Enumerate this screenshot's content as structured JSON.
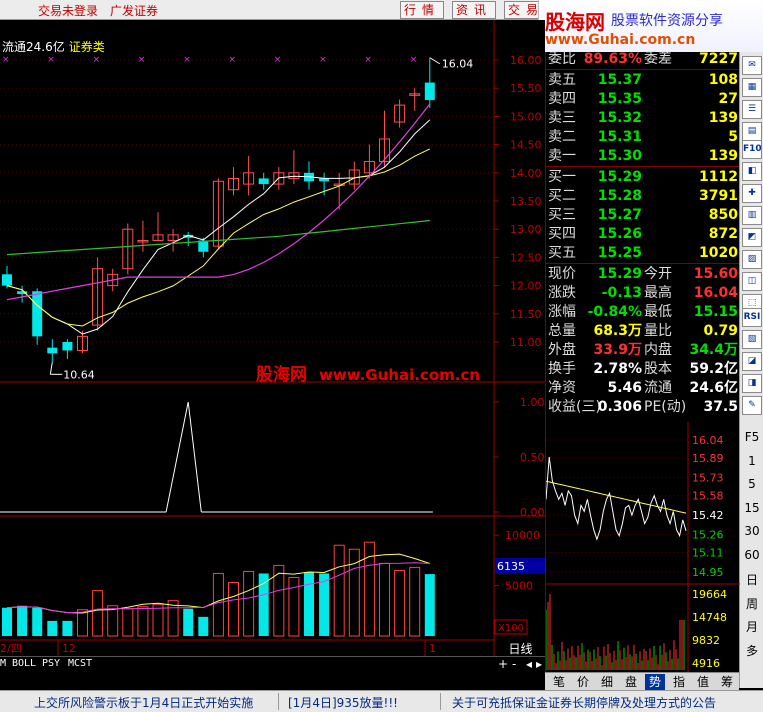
{
  "topbar": {
    "links": [
      "交易未登录",
      "广发证券"
    ],
    "buttons": [
      "行情",
      "资讯",
      "交易"
    ]
  },
  "brand": {
    "logo": "股海网",
    "slogan": "股票软件资源分享",
    "url": "www.Guhai.com.cn"
  },
  "chart_header": {
    "float_label": "流通24.6亿",
    "sector": "证券类"
  },
  "price_axis": [
    "16.00",
    "15.50",
    "15.00",
    "14.50",
    "14.00",
    "13.50",
    "13.00",
    "12.50",
    "12.00",
    "11.50",
    "11.00"
  ],
  "indicator_axis": [
    "1.00",
    "0.50",
    "0.00"
  ],
  "volume_axis": [
    "10000",
    "5000"
  ],
  "volume_marker": "6135",
  "volume_unit": "X100",
  "annotations": {
    "high": "16.04",
    "low": "10.64"
  },
  "watermark": {
    "text": "股海网",
    "url": "www.Guhai.com.cn"
  },
  "quote": {
    "top_row": {
      "label": "委比",
      "value": "89.63%",
      "label2": "委差",
      "value2": "7227"
    },
    "asks": [
      {
        "label": "卖五",
        "price": "15.37",
        "vol": "108"
      },
      {
        "label": "卖四",
        "price": "15.35",
        "vol": "27"
      },
      {
        "label": "卖三",
        "price": "15.32",
        "vol": "139"
      },
      {
        "label": "卖二",
        "price": "15.31",
        "vol": "5"
      },
      {
        "label": "卖一",
        "price": "15.30",
        "vol": "139"
      }
    ],
    "bids": [
      {
        "label": "买一",
        "price": "15.29",
        "vol": "1112"
      },
      {
        "label": "买二",
        "price": "15.28",
        "vol": "3791"
      },
      {
        "label": "买三",
        "price": "15.27",
        "vol": "850"
      },
      {
        "label": "买四",
        "price": "15.26",
        "vol": "872"
      },
      {
        "label": "买五",
        "price": "15.25",
        "vol": "1020"
      }
    ],
    "stats": [
      {
        "l1": "现价",
        "v1": "15.29",
        "l2": "今开",
        "v2": "15.60"
      },
      {
        "l1": "涨跌",
        "v1": "-0.13",
        "l2": "最高",
        "v2": "16.04"
      },
      {
        "l1": "涨幅",
        "v1": "-0.84%",
        "l2": "最低",
        "v2": "15.15"
      },
      {
        "l1": "总量",
        "v1": "68.3万",
        "l2": "量比",
        "v2": "0.79"
      },
      {
        "l1": "外盘",
        "v1": "33.9万",
        "l2": "内盘",
        "v2": "34.4万"
      },
      {
        "l1": "换手",
        "v1": "2.78%",
        "l2": "股本",
        "v2": "59.2亿"
      },
      {
        "l1": "净资",
        "v1": "5.46",
        "l2": "流通",
        "v2": "24.6亿"
      },
      {
        "l1": "收益(三)",
        "v1": "0.306",
        "l2": "PE(动)",
        "v2": "37.5"
      }
    ]
  },
  "mini_chart": {
    "price_labels": [
      "16.04",
      "15.89",
      "15.73",
      "15.58",
      "15.42",
      "15.26",
      "15.11",
      "14.95"
    ],
    "volume_labels": [
      "19664",
      "14748",
      "9832",
      "4916"
    ]
  },
  "mini_tabs": [
    "笔",
    "价",
    "细",
    "盘",
    "势",
    "指",
    "值",
    "筹"
  ],
  "active_mini_tab": "势",
  "side_tools": [
    "F10",
    "RSI"
  ],
  "side_numbers": [
    "F5",
    "1",
    "5",
    "15",
    "30",
    "60",
    "日",
    "周",
    "月",
    "多"
  ],
  "indicator_tabs": [
    "M",
    "BOLL",
    "PSY",
    "MCST"
  ],
  "period": "日线",
  "date_labels": [
    "2/四",
    "12",
    "1"
  ],
  "status_bar": [
    "上交所风险警示板于1月4日正式开始实施",
    "[1月4日]935放量!!!",
    "关于可充抵保证金证券长期停牌及处理方式的公告"
  ],
  "chart_data": {
    "type": "candlestick",
    "price_range": [
      10.64,
      16.04
    ],
    "candles": [
      {
        "o": 12.2,
        "c": 12.0,
        "h": 12.35,
        "l": 11.95
      },
      {
        "o": 11.9,
        "c": 11.85,
        "h": 12.0,
        "l": 11.7
      },
      {
        "o": 11.9,
        "c": 11.1,
        "h": 11.95,
        "l": 10.95
      },
      {
        "o": 10.9,
        "c": 10.8,
        "h": 11.05,
        "l": 10.64
      },
      {
        "o": 11.0,
        "c": 10.85,
        "h": 11.05,
        "l": 10.7
      },
      {
        "o": 10.85,
        "c": 11.1,
        "h": 11.2,
        "l": 10.8
      },
      {
        "o": 11.3,
        "c": 12.3,
        "h": 12.5,
        "l": 11.2
      },
      {
        "o": 12.0,
        "c": 12.2,
        "h": 12.3,
        "l": 11.9
      },
      {
        "o": 12.3,
        "c": 13.0,
        "h": 13.1,
        "l": 12.2
      },
      {
        "o": 12.8,
        "c": 12.8,
        "h": 13.15,
        "l": 12.6
      },
      {
        "o": 12.8,
        "c": 12.9,
        "h": 13.3,
        "l": 12.8
      },
      {
        "o": 12.8,
        "c": 12.9,
        "h": 13.0,
        "l": 12.6
      },
      {
        "o": 12.9,
        "c": 12.85,
        "h": 12.95,
        "l": 12.7
      },
      {
        "o": 12.8,
        "c": 12.6,
        "h": 12.85,
        "l": 12.5
      },
      {
        "o": 12.7,
        "c": 13.85,
        "h": 13.9,
        "l": 12.65
      },
      {
        "o": 13.7,
        "c": 13.9,
        "h": 14.1,
        "l": 13.6
      },
      {
        "o": 13.8,
        "c": 14.0,
        "h": 14.3,
        "l": 13.6
      },
      {
        "o": 13.9,
        "c": 13.8,
        "h": 14.0,
        "l": 13.7
      },
      {
        "o": 13.8,
        "c": 14.0,
        "h": 14.1,
        "l": 13.7
      },
      {
        "o": 13.9,
        "c": 14.0,
        "h": 14.4,
        "l": 13.8
      },
      {
        "o": 14.0,
        "c": 13.85,
        "h": 14.2,
        "l": 13.7
      },
      {
        "o": 13.9,
        "c": 13.85,
        "h": 14.0,
        "l": 13.6
      },
      {
        "o": 13.8,
        "c": 13.8,
        "h": 14.0,
        "l": 13.35
      },
      {
        "o": 13.8,
        "c": 14.05,
        "h": 14.2,
        "l": 13.7
      },
      {
        "o": 14.0,
        "c": 14.2,
        "h": 14.5,
        "l": 13.9
      },
      {
        "o": 14.2,
        "c": 14.6,
        "h": 15.1,
        "l": 14.1
      },
      {
        "o": 14.9,
        "c": 15.2,
        "h": 15.3,
        "l": 14.8
      },
      {
        "o": 15.4,
        "c": 15.4,
        "h": 15.5,
        "l": 15.1
      },
      {
        "o": 15.6,
        "c": 15.29,
        "h": 16.04,
        "l": 15.15
      }
    ],
    "volumes": [
      2800,
      3000,
      2800,
      1500,
      1500,
      2600,
      4500,
      3000,
      2700,
      2900,
      3100,
      3500,
      2700,
      1900,
      6200,
      5300,
      6400,
      6200,
      7000,
      5800,
      6300,
      6200,
      9000,
      8600,
      9300,
      7200,
      6500,
      6800,
      6135
    ],
    "indicator_peak_index": 12
  }
}
